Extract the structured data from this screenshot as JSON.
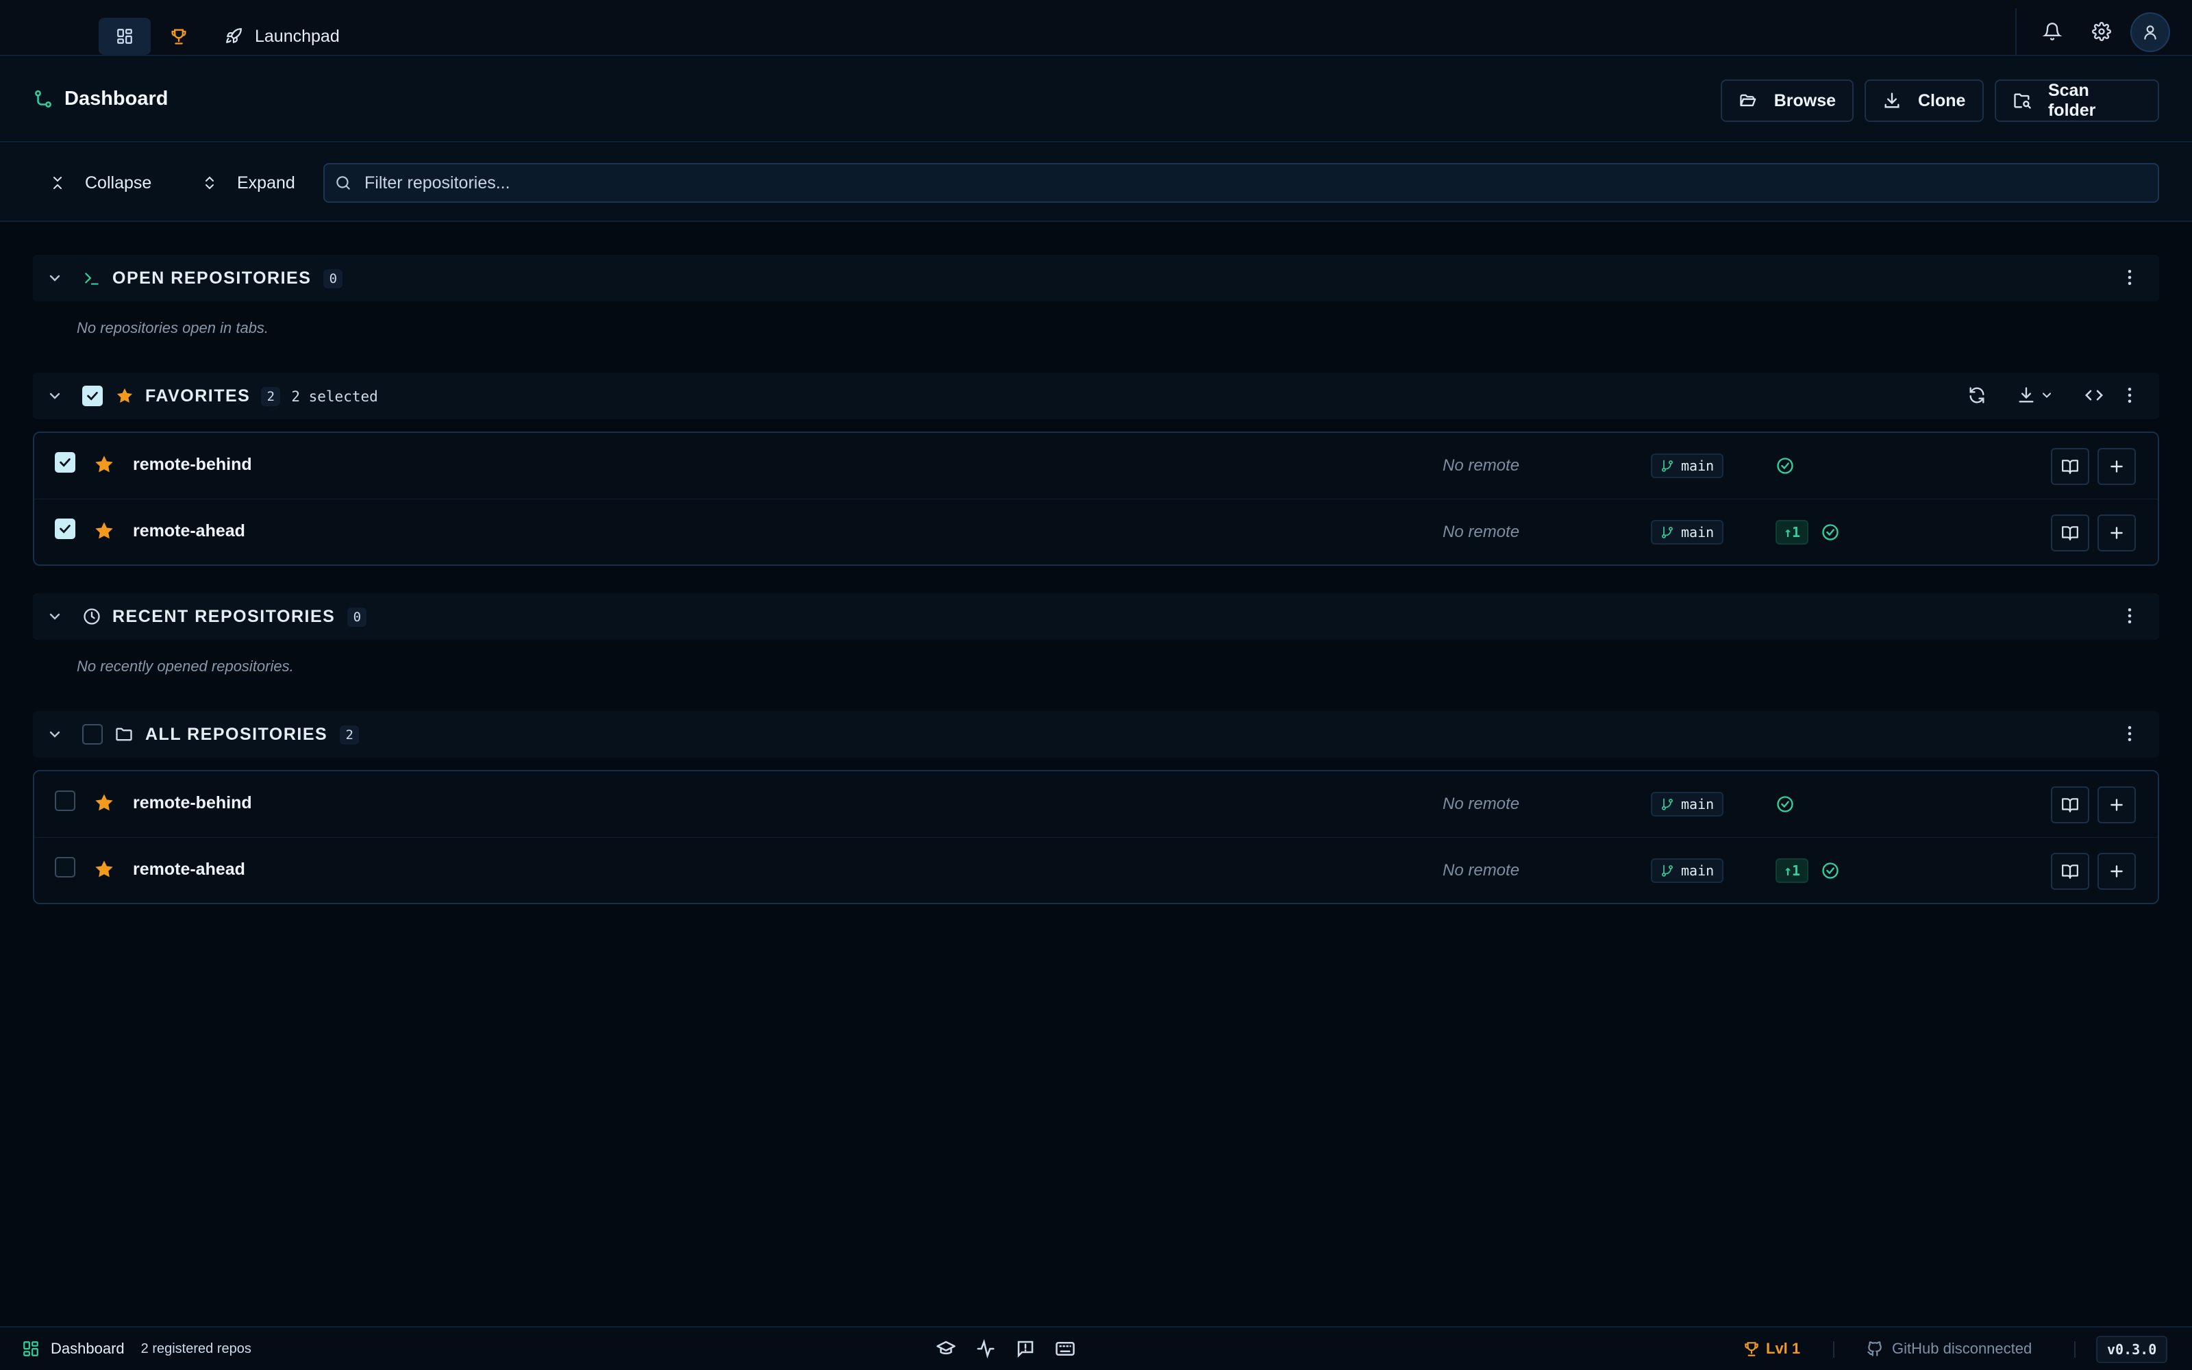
{
  "nav": {
    "launchpad_label": "Launchpad"
  },
  "header": {
    "title": "Dashboard",
    "browse_label": "Browse",
    "clone_label": "Clone",
    "scan_label": "Scan folder"
  },
  "toolbar": {
    "collapse_label": "Collapse",
    "expand_label": "Expand",
    "filter_placeholder": "Filter repositories..."
  },
  "sections": {
    "open": {
      "title": "OPEN REPOSITORIES",
      "count": "0",
      "empty": "No repositories open in tabs."
    },
    "favorites": {
      "title": "FAVORITES",
      "count": "2",
      "selected": "2 selected",
      "rows": [
        {
          "name": "remote-behind",
          "remote": "No remote",
          "branch": "main",
          "ahead": "",
          "checked": true
        },
        {
          "name": "remote-ahead",
          "remote": "No remote",
          "branch": "main",
          "ahead": "↑1",
          "checked": true
        }
      ]
    },
    "recent": {
      "title": "RECENT REPOSITORIES",
      "count": "0",
      "empty": "No recently opened repositories."
    },
    "all": {
      "title": "ALL REPOSITORIES",
      "count": "2",
      "rows": [
        {
          "name": "remote-behind",
          "remote": "No remote",
          "branch": "main",
          "ahead": "",
          "checked": false
        },
        {
          "name": "remote-ahead",
          "remote": "No remote",
          "branch": "main",
          "ahead": "↑1",
          "checked": false
        }
      ]
    }
  },
  "statusbar": {
    "view": "Dashboard",
    "repos": "2 registered repos",
    "level": "Lvl 1",
    "github": "GitHub disconnected",
    "version": "v0.3.0"
  },
  "colors": {
    "accent": "#2fd19e",
    "star": "#f29a1b",
    "background": "#040a12"
  }
}
